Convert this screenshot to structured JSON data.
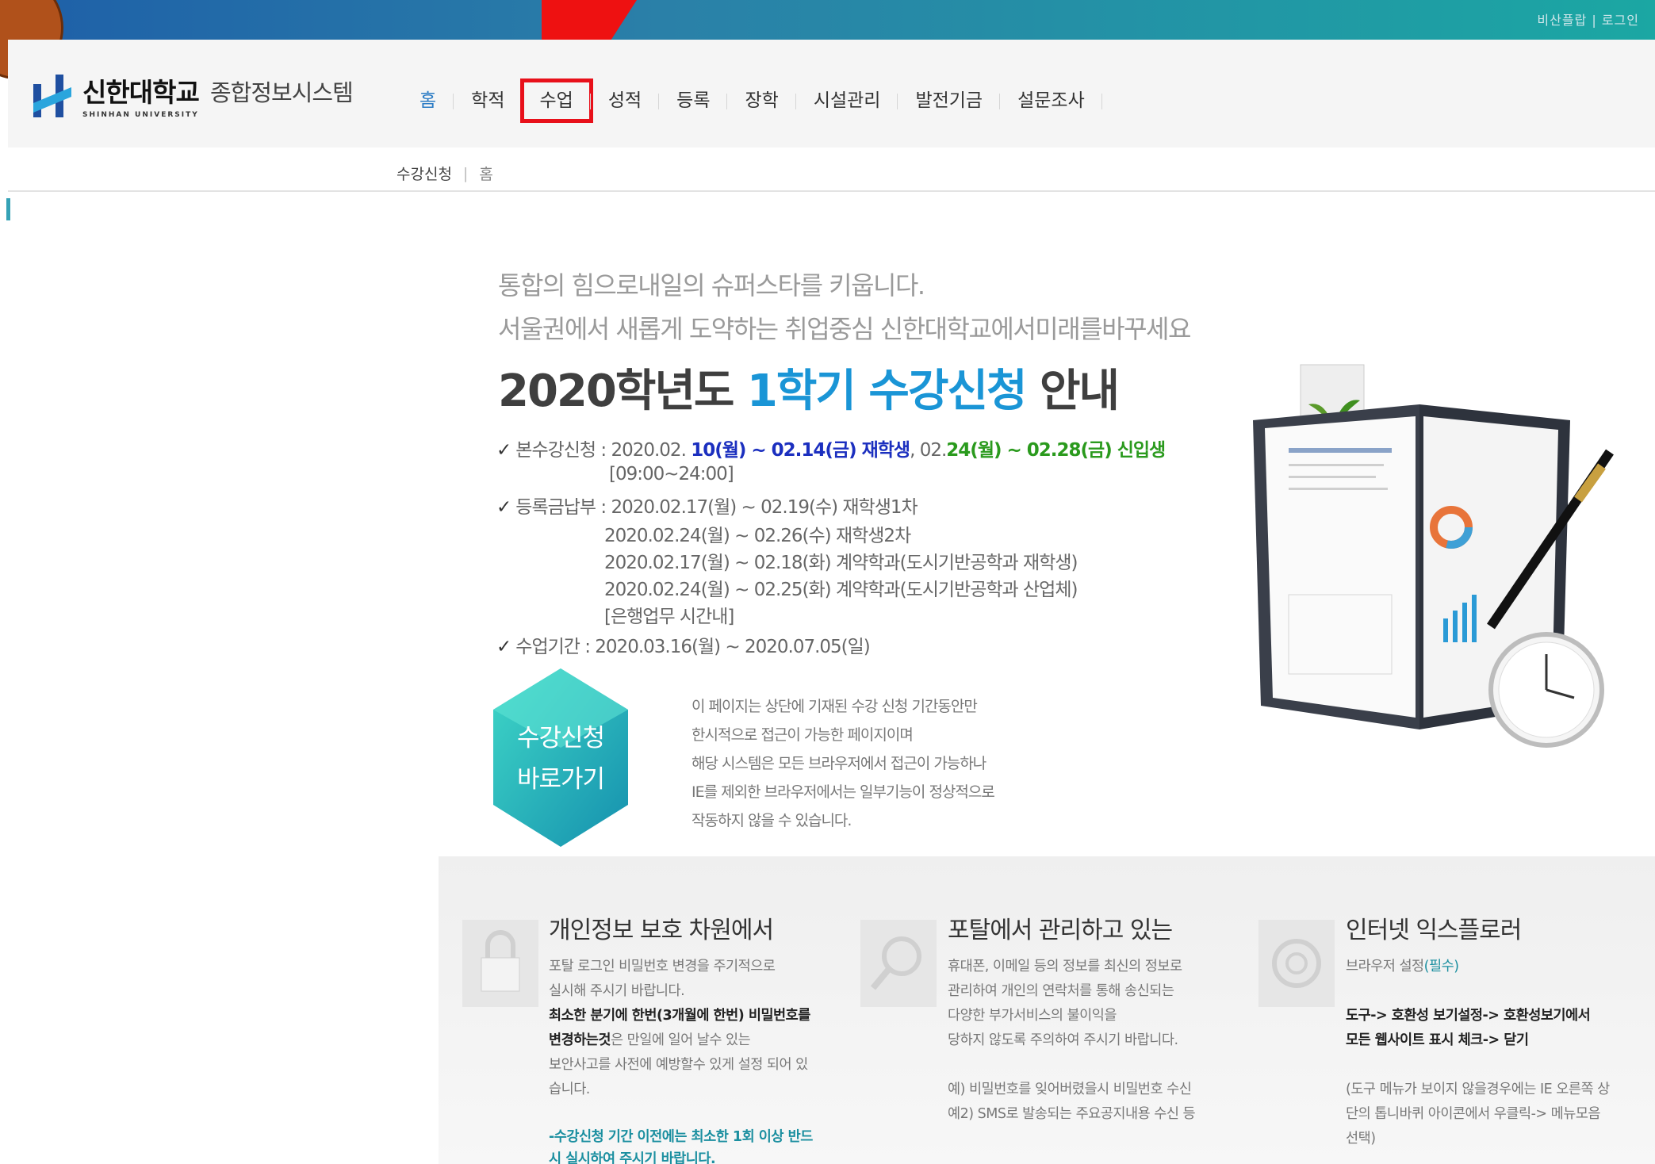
{
  "topbar": {
    "util_text": "비산플랍 | 로그인"
  },
  "header": {
    "logo_kr": "신한대학교",
    "logo_en": "SHINHAN UNIVERSITY",
    "system_name": "종합정보시스템",
    "nav": [
      "홈",
      "학적",
      "수업",
      "성적",
      "등록",
      "장학",
      "시설관리",
      "발전기금",
      "설문조사"
    ]
  },
  "breadcrumb": {
    "current": "수강신청",
    "sep": "|",
    "home": "홈"
  },
  "main": {
    "intro1": "통합의 힘으로내일의 슈퍼스타를 키웁니다.",
    "intro2": "서울권에서 새롭게 도약하는 취업중심 신한대학교에서미래를바꾸세요",
    "title_pre": "2020학년도",
    "title_blue": "1학기 수강신청",
    "title_post": "안내",
    "check": "✓",
    "enroll_label": "본수강신청 : 2020.02.",
    "enroll_blue": "10(월) ~ 02.14(금) 재학생",
    "enroll_mid": ", 02.",
    "enroll_green": "24(월) ~ 02.28(금) 신입생",
    "enroll_time": "[09:00~24:00]",
    "pay_label": "등록금납부 : 2020.02.17(월) ~ 02.19(수) 재학생1차",
    "pay_lines": [
      "2020.02.24(월) ~ 02.26(수) 재학생2차",
      "2020.02.17(월) ~ 02.18(화) 계약학과(도시기반공학과 재학생)",
      "2020.02.24(월) ~ 02.25(화) 계약학과(도시기반공학과 산업체)",
      "[은행업무 시간내]"
    ],
    "class_period": "수업기간 : 2020.03.16(월) ~ 2020.07.05(일)",
    "shortcut_line1": "수강신청",
    "shortcut_line2": "바로가기",
    "notice": [
      "이 페이지는 상단에 기재된 수강 신청 기간동안만",
      "한시적으로 접근이 가능한 페이지이며",
      "해당 시스템은 모든 브라우저에서 접근이 가능하나",
      "IE를 제외한 브라우저에서는 일부기능이 정상적으로",
      "작동하지 않을 수 있습니다."
    ]
  },
  "cards": [
    {
      "title": "개인정보 보호 차원에서",
      "line1": "포탈 로그인 비밀번호 변경을 주기적으로",
      "line2": "실시해 주시기 바랍니다.",
      "line3": "최소한 분기에 한번(3개월에 한번) 비밀번호를",
      "line4_bold": "변경하는것",
      "line4_rest": "은 만일에 일어 날수 있는",
      "line5": "보안사고를 사전에 예방할수 있게 설정 되어 있",
      "line6": "습니다.",
      "line7": "-수강신청 기간 이전에는 최소한 1회 이상 반드",
      "line8": "시 실시하여 주시기 바랍니다."
    },
    {
      "title": "포탈에서 관리하고 있는",
      "line1": "휴대폰, 이메일 등의 정보를 최신의 정보로",
      "line2": "관리하여 개인의 연락처를 통해 송신되는",
      "line3": "다양한 부가서비스의 불이익을",
      "line4": "당하지 않도록 주의하여 주시기 바랍니다.",
      "line5": "예) 비밀번호를 잊어버렸을시 비밀번호 수신",
      "line6": "예2) SMS로 발송되는 주요공지내용 수신 등"
    },
    {
      "title": "인터넷 익스플로러",
      "line1": "브라우저 설정",
      "line1_teal": "(필수)",
      "line2": "도구-> 호환성 보기설정-> 호환성보기에서",
      "line3": "모든 웹사이트 표시 체크-> 닫기",
      "line4": "(도구 메뉴가 보이지 않을경우에는 IE 오른쪽 상",
      "line5": "단의 톱니바퀴 아이콘에서 우클릭-> 메뉴모음",
      "line6": "선택)"
    }
  ],
  "colors": {
    "accent_blue": "#1a95d6",
    "highlight_red": "#e8101a",
    "teal": "#1ba7a3",
    "brown": "#b0511b"
  }
}
